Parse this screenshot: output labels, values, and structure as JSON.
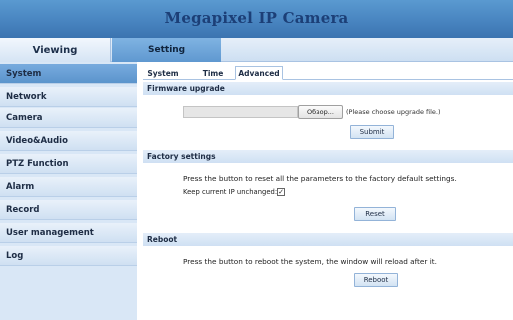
{
  "header": {
    "title": "Megapixel IP Camera"
  },
  "top_tabs": {
    "viewing": "Viewing",
    "setting": "Setting"
  },
  "sidebar": {
    "items": [
      {
        "label": "System",
        "active": true
      },
      {
        "label": "Network"
      },
      {
        "label": "Camera"
      },
      {
        "label": "Video&Audio"
      },
      {
        "label": "PTZ Function"
      },
      {
        "label": "Alarm"
      },
      {
        "label": "Record"
      },
      {
        "label": "User management"
      },
      {
        "label": "Log"
      }
    ]
  },
  "sub_tabs": {
    "system": "System",
    "time": "Time",
    "advanced": "Advanced"
  },
  "firmware": {
    "title": "Firmware upgrade",
    "browse_label": "Обзор...",
    "hint": "(Please choose upgrade file.)",
    "submit_label": "Submit"
  },
  "factory": {
    "title": "Factory settings",
    "description": "Press the button to reset all the parameters to the factory default settings.",
    "keep_ip_label": "Keep current IP unchanged:",
    "keep_ip_checked": true,
    "check_mark": "✓",
    "reset_label": "Reset"
  },
  "reboot": {
    "title": "Reboot",
    "description": "Press the button to reboot the system, the window will reload after it.",
    "reboot_label": "Reboot"
  }
}
